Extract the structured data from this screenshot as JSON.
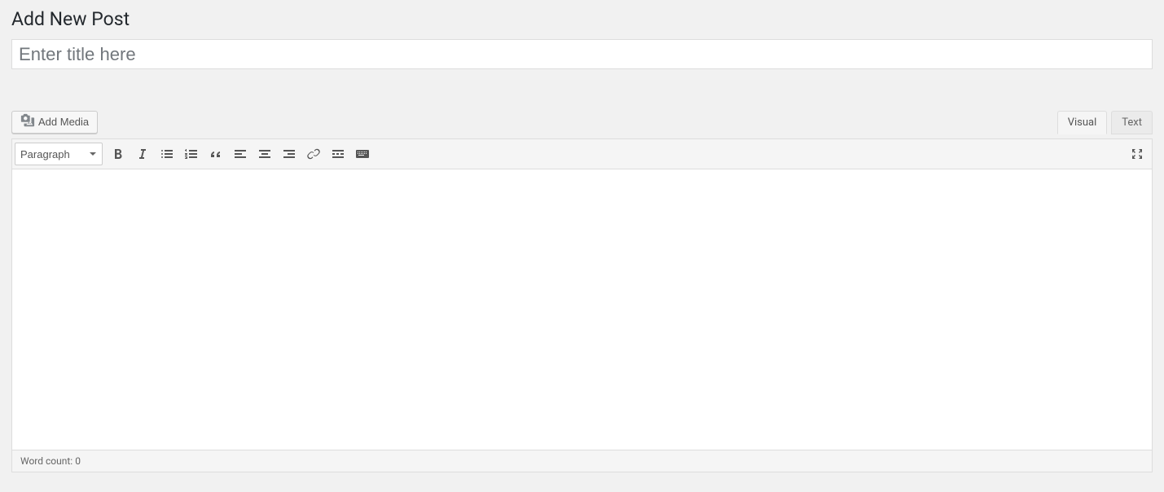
{
  "page": {
    "heading": "Add New Post",
    "title_placeholder": "Enter title here",
    "title_value": ""
  },
  "media_button": {
    "label": "Add Media"
  },
  "tabs": {
    "visual": "Visual",
    "text": "Text",
    "active": "visual"
  },
  "format_dropdown": {
    "selected": "Paragraph"
  },
  "toolbar_buttons": [
    "bold",
    "italic",
    "bullet-list",
    "numbered-list",
    "blockquote",
    "align-left",
    "align-center",
    "align-right",
    "link",
    "read-more",
    "toolbar-toggle"
  ],
  "fullscreen_button": "fullscreen",
  "content": "",
  "status": {
    "word_count_label": "Word count: ",
    "word_count_value": "0"
  }
}
